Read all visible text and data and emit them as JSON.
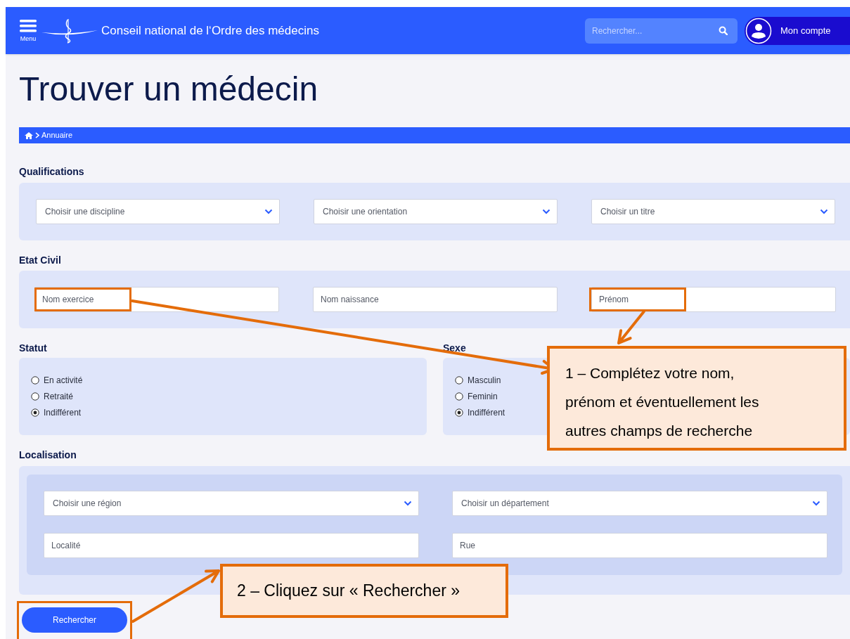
{
  "header": {
    "menu_label": "Menu",
    "site_title": "Conseil national de l‘Ordre des médecins",
    "search_placeholder": "Rechercher...",
    "account": "Mon compte"
  },
  "page_title": "Trouver un médecin",
  "breadcrumb": [
    "Annuaire"
  ],
  "qualifications": {
    "title": "Qualifications",
    "selects": [
      "Choisir une discipline",
      "Choisir une orientation",
      "Choisir un titre"
    ]
  },
  "etat_civil": {
    "title": "Etat Civil",
    "placeholders": [
      "Nom exercice",
      "Nom naissance",
      "Prénom"
    ]
  },
  "statut": {
    "title": "Statut",
    "options": [
      {
        "label": "En activité",
        "selected": false
      },
      {
        "label": "Retraité",
        "selected": false
      },
      {
        "label": "Indifférent",
        "selected": true
      }
    ]
  },
  "sexe": {
    "title": "Sexe",
    "options": [
      {
        "label": "Masculin",
        "selected": false
      },
      {
        "label": "Feminin",
        "selected": false
      },
      {
        "label": "Indifférent",
        "selected": true
      }
    ]
  },
  "localisation": {
    "title": "Localisation",
    "selects": [
      "Choisir une région",
      "Choisir un département"
    ],
    "placeholders": [
      "Localité",
      "Rue"
    ]
  },
  "submit": "Rechercher",
  "annotations": [
    "1 – Complétez votre nom, prénom et éventuellement les autres champs de recherche",
    "2 – Cliquez sur « Rechercher »"
  ]
}
